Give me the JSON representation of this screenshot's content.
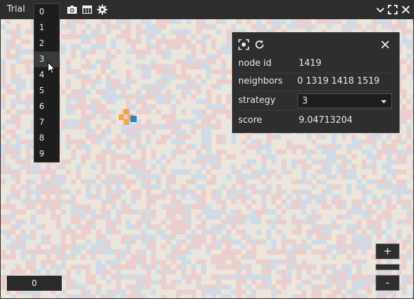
{
  "toolbar": {
    "title": "Trial",
    "selected_trial": "3",
    "icons": [
      "camera-icon",
      "table-icon",
      "gear-icon",
      "chevron-down-icon",
      "fullscreen-icon",
      "close-icon"
    ]
  },
  "trial_options": [
    "0",
    "1",
    "2",
    "3",
    "4",
    "5",
    "6",
    "7",
    "8",
    "9"
  ],
  "info_panel": {
    "icons": [
      "focus-icon",
      "refresh-icon",
      "close-icon"
    ],
    "rows": [
      {
        "key": "node id",
        "value": "1419"
      },
      {
        "key": "neighbors",
        "value": "0 1319 1418 1519"
      },
      {
        "key": "strategy",
        "value": "3"
      },
      {
        "key": "score",
        "value": "9.04713204"
      }
    ]
  },
  "zoom": {
    "in_label": "+",
    "out_label": "-"
  },
  "counter": "0",
  "colors": {
    "red": "#ebcfcf",
    "blue": "#cfdbe6",
    "cream": "#efe5d8",
    "light": "#e7e6e0",
    "orange": "#f0a650",
    "highlight_blue": "#2f7fc0"
  }
}
